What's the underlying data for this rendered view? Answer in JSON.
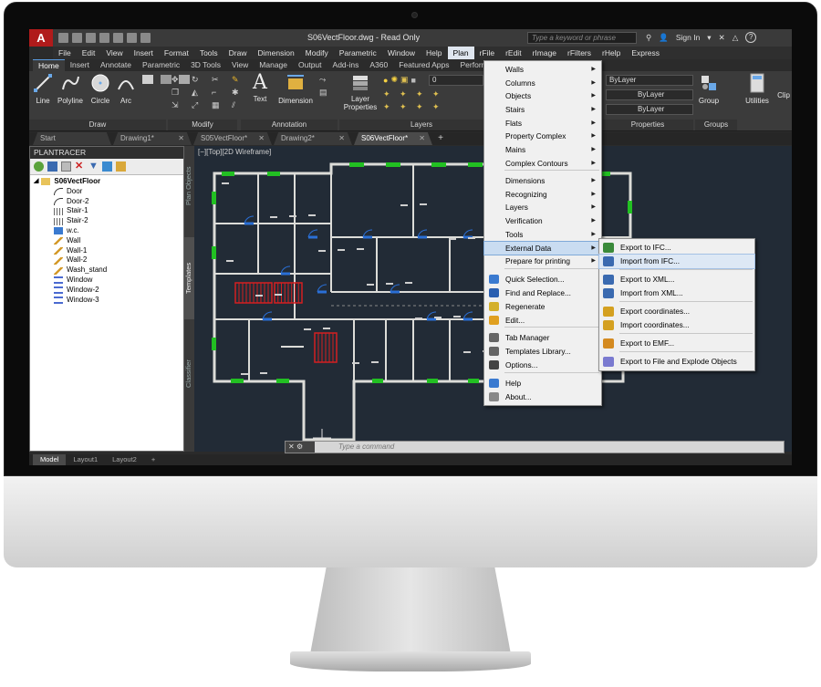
{
  "titlebar": {
    "title": "S06VectFloor.dwg - Read Only",
    "search_placeholder": "Type a keyword or phrase",
    "sign_in": "Sign In"
  },
  "menubar": [
    "File",
    "Edit",
    "View",
    "Insert",
    "Format",
    "Tools",
    "Draw",
    "Dimension",
    "Modify",
    "Parametric",
    "Window",
    "Help",
    "Plan",
    "rFile",
    "rEdit",
    "rImage",
    "rFilters",
    "rHelp",
    "Express"
  ],
  "menubar_active": "Plan",
  "ribbon_tabs": [
    "Home",
    "Insert",
    "Annotate",
    "Parametric",
    "3D Tools",
    "View",
    "Manage",
    "Output",
    "Add-ins",
    "A360",
    "Featured Apps",
    "Perform"
  ],
  "ribbon_active": "Home",
  "ribbon": {
    "line": "Line",
    "polyline": "Polyline",
    "circle": "Circle",
    "arc": "Arc",
    "text": "Text",
    "dimension": "Dimension",
    "layer_properties_1": "Layer",
    "layer_properties_2": "Properties",
    "group": "Group",
    "utilities": "Utilities",
    "clip": "Clip",
    "panel_draw": "Draw",
    "panel_modify": "Modify",
    "panel_annotation": "Annotation",
    "panel_layers": "Layers",
    "panel_properties": "Properties",
    "panel_groups": "Groups",
    "layer_value": "0",
    "bylayer_1": "ByLayer",
    "bylayer_2": "ByLayer",
    "bylayer_3": "ByLayer"
  },
  "doc_tabs": [
    {
      "label": "Start",
      "active": false
    },
    {
      "label": "Drawing1*",
      "active": false
    },
    {
      "label": "S05VectFloor*",
      "active": false
    },
    {
      "label": "Drawing2*",
      "active": false
    },
    {
      "label": "S06VectFloor*",
      "active": true
    }
  ],
  "plantracer": {
    "header": "PLANTRACER",
    "root": "S06VectFloor",
    "items": [
      "Door",
      "Door-2",
      "Stair-1",
      "Stair-2",
      "w.c.",
      "Wall",
      "Wall-1",
      "Wall-2",
      "Wash_stand",
      "Window",
      "Window-2",
      "Window-3"
    ]
  },
  "side_tabs": [
    "Plan Objects",
    "Templates",
    "Classifier"
  ],
  "viewport_label": "[−][Top][2D Wireframe]",
  "command_placeholder": "Type a command",
  "bottom_tabs": [
    "Model",
    "Layout1",
    "Layout2"
  ],
  "plan_menu": {
    "items": [
      "Walls",
      "Columns",
      "Objects",
      "Stairs",
      "Flats",
      "Property Complex",
      "Mains",
      "Complex Contours",
      "Dimensions",
      "Recognizing",
      "Layers",
      "Verification",
      "Tools",
      "External Data",
      "Prepare for printing",
      "Quick Selection...",
      "Find and Replace...",
      "Regenerate",
      "Edit...",
      "Tab Manager",
      "Templates Library...",
      "Options...",
      "Help",
      "About..."
    ],
    "highlighted": "External Data"
  },
  "sub_menu": {
    "items": [
      "Export to IFC...",
      "Import from IFC...",
      "Export to XML...",
      "Import from XML...",
      "Export coordinates...",
      "Import coordinates...",
      "Export to EMF...",
      "Export to File and Explode Objects"
    ],
    "highlighted": "Import from IFC..."
  },
  "colors": {
    "autocad_red": "#b01b1b",
    "drawing_bg": "#222b36",
    "wall_color": "#dcdcd8",
    "window_green": "#22c022",
    "door_blue": "#2a6fd6",
    "stair_red": "#d42020",
    "menu_highlight": "#c9dcf1"
  }
}
